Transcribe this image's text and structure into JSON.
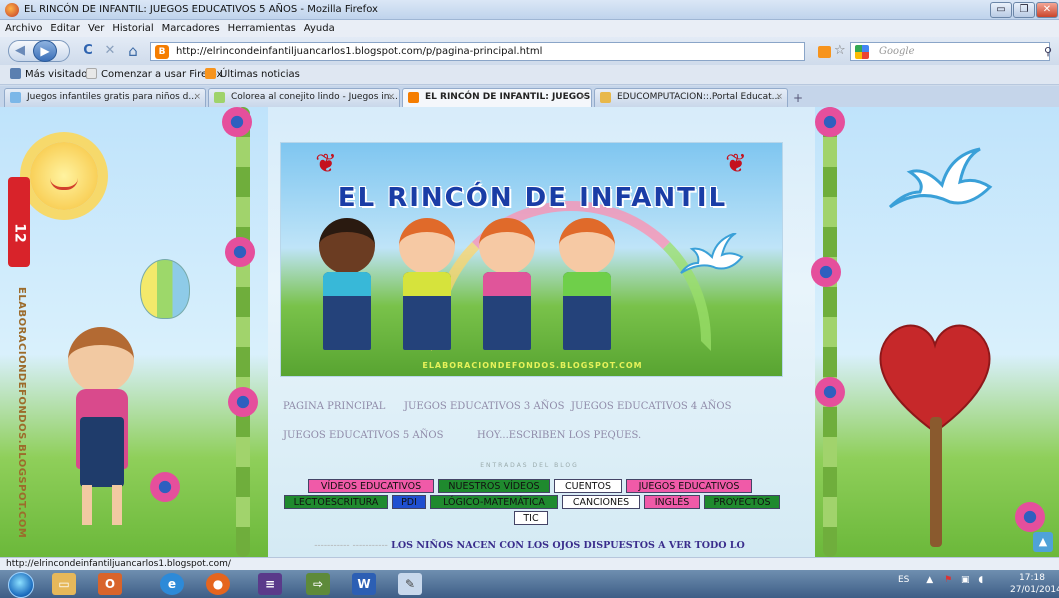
{
  "window": {
    "title": "EL RINCÓN DE INFANTIL: JUEGOS EDUCATIVOS 5 AÑOS - Mozilla Firefox",
    "min": "▭",
    "max": "❐",
    "close": "✕"
  },
  "menu": [
    "Archivo",
    "Editar",
    "Ver",
    "Historial",
    "Marcadores",
    "Herramientas",
    "Ayuda"
  ],
  "navbar": {
    "url": "http://elrincondeinfantiljuancarlos1.blogspot.com/p/pagina-principal.html",
    "search_placeholder": "Google",
    "back": "◀",
    "forward": "▶",
    "reload": "C",
    "stop": "✕",
    "home": "⌂"
  },
  "bookmarks": [
    {
      "label": "Más visitados",
      "icon": "star-folder-icon",
      "color": "#5b7fb0"
    },
    {
      "label": "Comenzar a usar Firefox",
      "icon": "page-icon",
      "color": "#e8e8e8"
    },
    {
      "label": "Últimas noticias",
      "icon": "rss-icon",
      "color": "#f7941d"
    }
  ],
  "tabs": [
    {
      "label": "Juegos infantiles gratis para niños d...",
      "color": "#7cb7e8",
      "active": false
    },
    {
      "label": "Colorea al conejito lindo - Juegos in...",
      "color": "#9fd36b",
      "active": false
    },
    {
      "label": "EL RINCÓN DE INFANTIL: JUEGOS...",
      "color": "#f57d00",
      "active": true
    },
    {
      "label": "EDUCOMPUTACION::.Portal Educat...",
      "color": "#e8b84a",
      "active": false
    }
  ],
  "page": {
    "banner_title": "EL RINCÓN DE INFANTIL",
    "banner_watermark": "ELABORACIONDEFONDOS.BLOGSPOT.COM",
    "side_vertical_text": "ELABORACIONDEFONDOS.BLOGSPOT.COM",
    "side_badge": "12",
    "nav_links": [
      "PAGINA PRINCIPAL",
      "JUEGOS EDUCATIVOS 3 AÑOS",
      "JUEGOS EDUCATIVOS 4 AÑOS",
      "JUEGOS EDUCATIVOS 5 AÑOS",
      "HOY...ESCRIBEN LOS PEQUES."
    ],
    "entradas_heading": "ENTRADAS DEL BLOG",
    "labels": [
      {
        "text": "VÍDEOS EDUCATIVOS",
        "color": "#f05aa8"
      },
      {
        "text": "NUESTROS VÍDEOS",
        "color": "#1f8a2e"
      },
      {
        "text": "CUENTOS",
        "color": "#ffffff"
      },
      {
        "text": "JUEGOS EDUCATIVOS",
        "color": "#f05aa8"
      },
      {
        "text": "LECTOESCRITURA",
        "color": "#1f8a2e"
      },
      {
        "text": "PDI",
        "color": "#1f4fd0"
      },
      {
        "text": "LÓGICO-MATEMÁTICA",
        "color": "#1f8a2e"
      },
      {
        "text": "CANCIONES",
        "color": "#ffffff"
      },
      {
        "text": "INGLÉS",
        "color": "#f05aa8"
      },
      {
        "text": "PROYECTOS",
        "color": "#1f8a2e"
      },
      {
        "text": "TIC",
        "color": "#ffffff"
      }
    ],
    "quote": "LOS NIÑOS NACEN CON LOS OJOS DISPUESTOS A VER TODO LO",
    "quote_dashes": "----------- -----------"
  },
  "status": "http://elrincondeinfantiljuancarlos1.blogspot.com/",
  "taskbar": {
    "language": "ES",
    "time": "17:18",
    "date": "27/01/2014"
  }
}
